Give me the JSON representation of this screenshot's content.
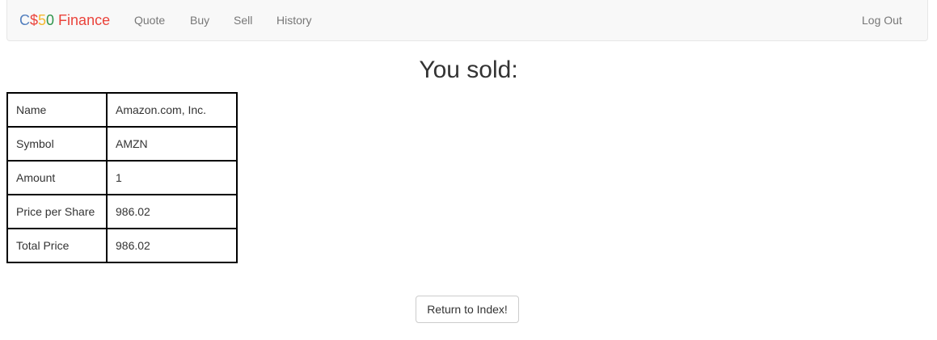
{
  "navbar": {
    "brand": {
      "c": "C",
      "dollar": "$",
      "five": "5",
      "zero": "0",
      "finance": " Finance"
    },
    "links": [
      {
        "label": "Quote"
      },
      {
        "label": "Buy"
      },
      {
        "label": "Sell"
      },
      {
        "label": "History"
      }
    ],
    "logout_label": "Log Out"
  },
  "main": {
    "title": "You sold:",
    "rows": [
      {
        "label": "Name",
        "value": "Amazon.com, Inc."
      },
      {
        "label": "Symbol",
        "value": "AMZN"
      },
      {
        "label": "Amount",
        "value": "1"
      },
      {
        "label": "Price per Share",
        "value": "986.02"
      },
      {
        "label": "Total Price",
        "value": "986.02"
      }
    ],
    "return_button_label": "Return to Index!"
  },
  "colors": {
    "brand_blue": "#537fbe",
    "brand_red": "#ea433b",
    "brand_yellow": "#f5b82e",
    "brand_green": "#2e944b",
    "navbar_bg": "#f8f8f8",
    "nav_link": "#777777"
  }
}
